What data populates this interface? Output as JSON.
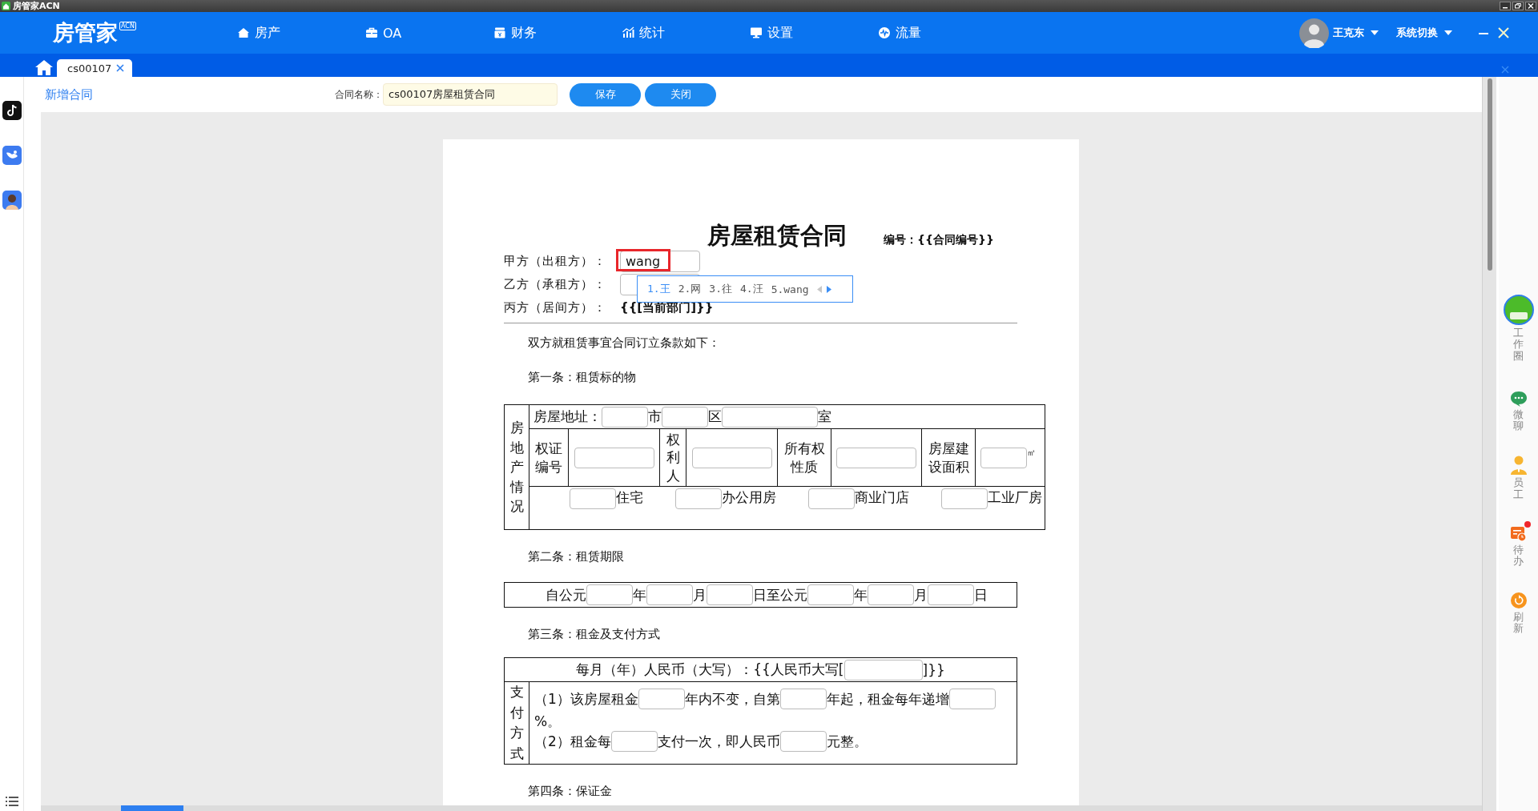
{
  "app": {
    "title": "房管家ACN"
  },
  "header": {
    "logo": "房管家",
    "logo_badge": "ACN",
    "nav": [
      {
        "label": "房产",
        "kind": "home"
      },
      {
        "label": "OA",
        "kind": "briefcase"
      },
      {
        "label": "财务",
        "kind": "wallet"
      },
      {
        "label": "统计",
        "kind": "chart"
      },
      {
        "label": "设置",
        "kind": "monitor"
      },
      {
        "label": "流量",
        "kind": "pulse"
      }
    ],
    "user": {
      "name": "王克东"
    },
    "system_menu": "系统切换"
  },
  "tabs": [
    {
      "label": "cs00107",
      "selected": true
    }
  ],
  "toolbar": {
    "page_title": "新增合同",
    "contract_name_label": "合同名称：",
    "contract_name": "cs00107房屋租赁合同",
    "buttons": [
      "保存",
      "关闭"
    ]
  },
  "right_dock": [
    {
      "label": "工作圈",
      "kind": "avatar",
      "badge": false
    },
    {
      "label": "微聊",
      "kind": "chat",
      "badge": false
    },
    {
      "label": "员工",
      "kind": "person",
      "badge": false
    },
    {
      "label": "待办",
      "kind": "todo",
      "badge": true
    },
    {
      "label": "刷新",
      "kind": "refresh",
      "badge": false
    }
  ],
  "document": {
    "title": "房屋租赁合同",
    "number_label": "编号：{{合同编号}}",
    "parties": [
      {
        "label": "甲方（出租方）：",
        "kind": "input",
        "value": "wang",
        "highlighted": true
      },
      {
        "label": "乙方（承租方）：",
        "kind": "input",
        "highlighted": false
      },
      {
        "label": "丙方（居间方）：",
        "kind": "text",
        "value": "{{[当前部门]}}"
      }
    ],
    "ime": {
      "candidates": [
        {
          "label": "1.王",
          "selected": true
        },
        {
          "label": "2.网",
          "selected": false
        },
        {
          "label": "3.往",
          "selected": false
        },
        {
          "label": "4.汪",
          "selected": false
        },
        {
          "label": "5.wang",
          "selected": false
        }
      ]
    },
    "intro": "双方就租赁事宜合同订立条款如下：",
    "articles": [
      {
        "heading": "第一条：租赁标的物",
        "table": {
          "kind": "property",
          "side_label": "房地产情况",
          "rows": [
            {
              "cells": [
                {
                  "kind": "line",
                  "parts": [
                    {
                      "kind": "text",
                      "text": "房屋地址："
                    },
                    {
                      "kind": "blank"
                    },
                    {
                      "kind": "text",
                      "text": "市"
                    },
                    {
                      "kind": "blank"
                    },
                    {
                      "kind": "text",
                      "text": "区"
                    },
                    {
                      "kind": "wide_blank"
                    },
                    {
                      "kind": "text",
                      "text": "室"
                    }
                  ]
                }
              ]
            },
            {
              "cells": [
                {
                  "kind": "label",
                  "parts": [
                    {
                      "kind": "text",
                      "text": "权证编号"
                    }
                  ]
                },
                {
                  "kind": "field",
                  "parts": [
                    {
                      "kind": "long_blank"
                    }
                  ]
                },
                {
                  "kind": "label",
                  "parts": [
                    {
                      "kind": "text",
                      "text": "权利人"
                    }
                  ]
                },
                {
                  "kind": "field",
                  "parts": [
                    {
                      "kind": "long_blank"
                    }
                  ]
                },
                {
                  "kind": "label",
                  "parts": [
                    {
                      "kind": "text",
                      "text": "所有权性质"
                    }
                  ]
                },
                {
                  "kind": "field",
                  "parts": [
                    {
                      "kind": "long_blank"
                    }
                  ]
                },
                {
                  "kind": "label",
                  "parts": [
                    {
                      "kind": "text",
                      "text": "房屋建设面积"
                    }
                  ]
                },
                {
                  "kind": "field",
                  "parts": [
                    {
                      "kind": "blank"
                    },
                    {
                      "kind": "unit",
                      "text": "㎡"
                    }
                  ]
                }
              ]
            },
            {
              "cells": [
                {
                  "kind": "line",
                  "parts": [
                    {
                      "kind": "blank"
                    },
                    {
                      "kind": "text",
                      "text": "住宅"
                    },
                    {
                      "kind": "blank"
                    },
                    {
                      "kind": "text",
                      "text": "办公用房"
                    },
                    {
                      "kind": "blank"
                    },
                    {
                      "kind": "text",
                      "text": "商业门店"
                    },
                    {
                      "kind": "blank"
                    },
                    {
                      "kind": "text",
                      "text": "工业厂房"
                    }
                  ]
                }
              ]
            }
          ]
        }
      },
      {
        "heading": "第二条：租赁期限",
        "table": {
          "kind": "period",
          "rows": [
            {
              "cells": [
                {
                  "kind": "line",
                  "parts": [
                    {
                      "kind": "text",
                      "text": "自公元"
                    },
                    {
                      "kind": "blank"
                    },
                    {
                      "kind": "text",
                      "text": "年"
                    },
                    {
                      "kind": "blank"
                    },
                    {
                      "kind": "text",
                      "text": "月"
                    },
                    {
                      "kind": "blank"
                    },
                    {
                      "kind": "text",
                      "text": "日至公元"
                    },
                    {
                      "kind": "blank"
                    },
                    {
                      "kind": "text",
                      "text": "年"
                    },
                    {
                      "kind": "blank"
                    },
                    {
                      "kind": "text",
                      "text": "月"
                    },
                    {
                      "kind": "blank"
                    },
                    {
                      "kind": "text",
                      "text": "日"
                    }
                  ]
                }
              ]
            }
          ]
        }
      },
      {
        "heading": "第三条：租金及支付方式",
        "table": {
          "kind": "payment",
          "header": {
            "parts": [
              {
                "kind": "text",
                "text": "每月（年）人民币（大写）：{{人民币大写["
              },
              {
                "kind": "wide_blank"
              },
              {
                "kind": "text",
                "text": "]}}"
              }
            ]
          },
          "side_label": "支付方式",
          "rows": [
            {
              "cells": [
                {
                  "kind": "line",
                  "parts": [
                    {
                      "kind": "text",
                      "text": "（1）该房屋租金"
                    },
                    {
                      "kind": "blank"
                    },
                    {
                      "kind": "text",
                      "text": "年内不变，自第"
                    },
                    {
                      "kind": "blank"
                    },
                    {
                      "kind": "text",
                      "text": "年起，租金每年递增"
                    },
                    {
                      "kind": "blank"
                    },
                    {
                      "kind": "text",
                      "text": "%。"
                    }
                  ]
                }
              ]
            },
            {
              "cells": [
                {
                  "kind": "line",
                  "parts": [
                    {
                      "kind": "text",
                      "text": "（2）租金每"
                    },
                    {
                      "kind": "blank"
                    },
                    {
                      "kind": "text",
                      "text": "支付一次，即人民币"
                    },
                    {
                      "kind": "blank"
                    },
                    {
                      "kind": "text",
                      "text": "元整。"
                    }
                  ]
                }
              ]
            }
          ]
        }
      },
      {
        "heading": "第四条：保证金"
      }
    ]
  }
}
